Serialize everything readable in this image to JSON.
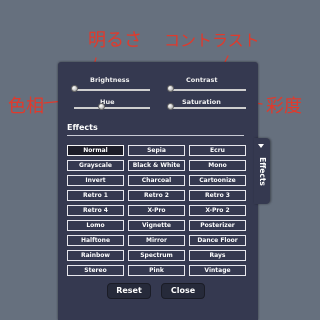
{
  "annotations": {
    "brightness": "明るさ",
    "contrast": "コントラスト",
    "hue": "色相",
    "saturation": "彩度",
    "color": "#e03a2c"
  },
  "sliders": {
    "brightness": {
      "label": "Brightness",
      "level": 0.0
    },
    "contrast": {
      "label": "Contrast",
      "level": 0.0
    },
    "hue": {
      "label": "Hue",
      "level": 0.35
    },
    "saturation": {
      "label": "Saturation",
      "level": 0.0
    }
  },
  "effects": {
    "title": "Effects",
    "selected": "Normal",
    "items": [
      "Normal",
      "Sepia",
      "Ecru",
      "Grayscale",
      "Black & White",
      "Mono",
      "Invert",
      "Charcoal",
      "Cartoonize",
      "Retro 1",
      "Retro 2",
      "Retro 3",
      "Retro 4",
      "X-Pro",
      "X-Pro 2",
      "Lomo",
      "Vignette",
      "Posterizer",
      "Halftone",
      "Mirror",
      "Dance Floor",
      "Rainbow",
      "Spectrum",
      "Rays",
      "Stereo",
      "Pink",
      "Vintage"
    ]
  },
  "buttons": {
    "reset": "Reset",
    "close": "Close"
  },
  "tab": {
    "label": "Effects",
    "icon": "chevron-down-icon"
  },
  "colors": {
    "background": "#66707e",
    "panel": "#353950",
    "selected_button": "#1c1d28"
  }
}
